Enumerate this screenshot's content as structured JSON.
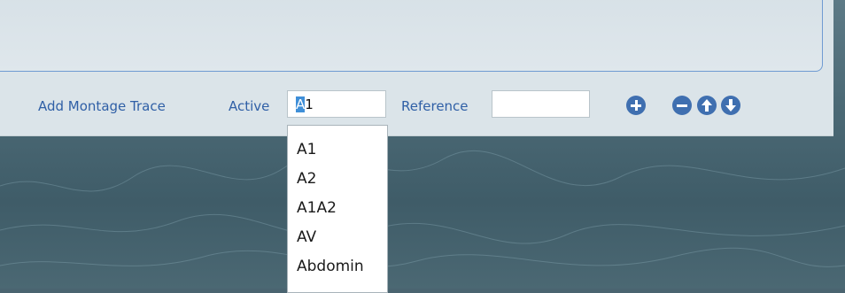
{
  "toolbar": {
    "add_montage_trace_label": "Add Montage Trace",
    "active_label": "Active",
    "active_value": "A1",
    "reference_label": "Reference",
    "reference_value": ""
  },
  "dropdown": {
    "options": [
      "A1",
      "A2",
      "A1A2",
      "AV",
      "Abdomin"
    ]
  },
  "icons": {
    "add": "plus-circle-icon",
    "remove": "minus-circle-icon",
    "move_up": "arrow-up-circle-icon",
    "move_down": "arrow-down-circle-icon"
  },
  "colors": {
    "label_blue": "#2f5fa6",
    "icon_blue": "#3f6fb0",
    "panel": "#dbe4e9",
    "background": "#4a6470"
  }
}
